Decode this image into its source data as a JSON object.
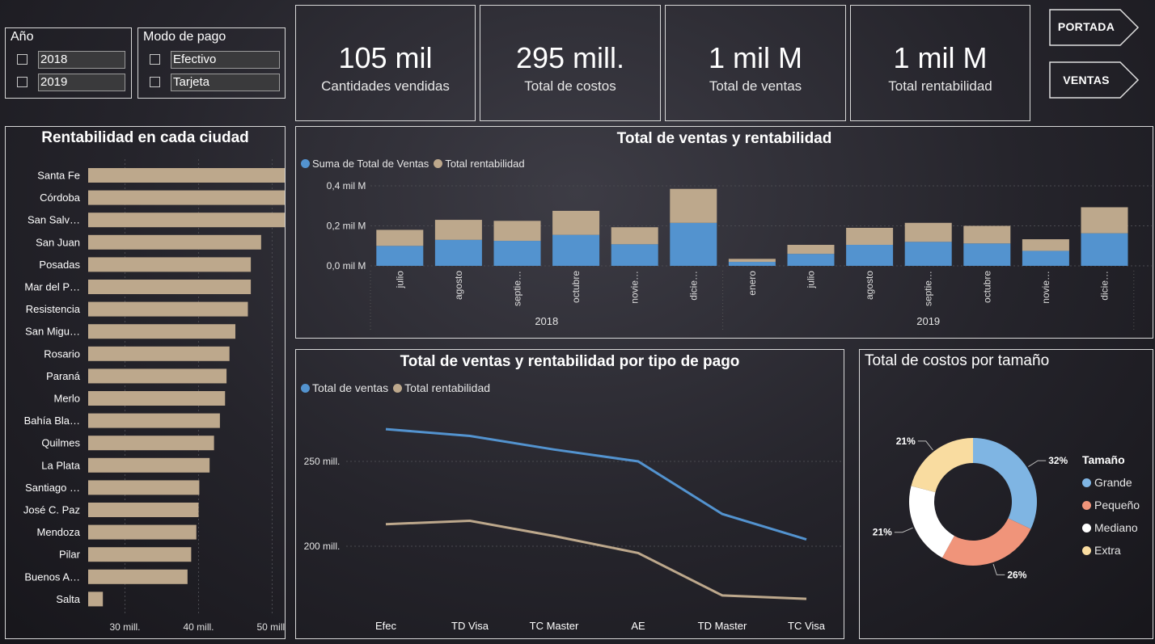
{
  "colors": {
    "blue": "#5393cf",
    "tan": "#bda88c",
    "border": "#d8d8d8",
    "grande": "#7fb5e3",
    "pequeno": "#f0947a",
    "mediano": "#ffffff",
    "extra": "#f9dca0"
  },
  "slicers": {
    "year": {
      "title": "Año",
      "options": [
        "2018",
        "2019"
      ]
    },
    "payment": {
      "title": "Modo de pago",
      "options": [
        "Efectivo",
        "Tarjeta"
      ]
    }
  },
  "kpis": [
    {
      "value": "105 mil",
      "label": "Cantidades vendidas"
    },
    {
      "value": "295 mill.",
      "label": "Total de costos"
    },
    {
      "value": "1 mil M",
      "label": "Total de ventas"
    },
    {
      "value": "1 mil M",
      "label": "Total rentabilidad"
    }
  ],
  "nav": {
    "portada": "PORTADA",
    "ventas": "VENTAS"
  },
  "charts": {
    "city": {
      "title": "Rentabilidad en cada ciudad"
    },
    "monthly": {
      "title": "Total de ventas y rentabilidad",
      "legend": [
        "Suma de Total de Ventas",
        "Total rentabilidad"
      ],
      "years": [
        "2018",
        "2019"
      ]
    },
    "payment": {
      "title": "Total de ventas y rentabilidad por tipo de pago",
      "legend": [
        "Total de ventas",
        "Total rentabilidad"
      ]
    },
    "size": {
      "title": "Total de costos por tamaño",
      "legend_title": "Tamaño",
      "legend": [
        "Grande",
        "Pequeño",
        "Mediano",
        "Extra"
      ]
    }
  },
  "chart_data": [
    {
      "type": "bar",
      "orientation": "horizontal",
      "title": "Rentabilidad en cada ciudad",
      "categories": [
        "Santa Fe",
        "Córdoba",
        "San Salv…",
        "San Juan",
        "Posadas",
        "Mar del P…",
        "Resistencia",
        "San Migu…",
        "Rosario",
        "Paraná",
        "Merlo",
        "Bahía Bla…",
        "Quilmes",
        "La Plata",
        "Santiago …",
        "José C. Paz",
        "Mendoza",
        "Pilar",
        "Buenos A…",
        "Salta"
      ],
      "values": [
        54.1,
        53.4,
        53.3,
        48.5,
        47.1,
        47.1,
        46.7,
        45.0,
        44.2,
        43.8,
        43.6,
        42.9,
        42.1,
        41.5,
        40.1,
        40.0,
        39.7,
        39.0,
        38.5,
        27.0
      ],
      "x_ticks": [
        "30 mill.",
        "40 mill.",
        "50 mill."
      ],
      "xlim_millions": [
        25,
        55
      ]
    },
    {
      "type": "bar",
      "stacked": true,
      "title": "Total de ventas y rentabilidad",
      "categories": [
        "julio",
        "agosto",
        "septie…",
        "octubre",
        "novie…",
        "dicie…",
        "enero",
        "julio",
        "agosto",
        "septie…",
        "octubre",
        "novie…",
        "dicie…"
      ],
      "year_groups": [
        {
          "label": "2018",
          "count": 6
        },
        {
          "label": "2019",
          "count": 7
        }
      ],
      "series": [
        {
          "name": "Suma de Total de Ventas",
          "values": [
            0.1,
            0.13,
            0.125,
            0.155,
            0.108,
            0.215,
            0.02,
            0.06,
            0.105,
            0.12,
            0.112,
            0.075,
            0.163
          ]
        },
        {
          "name": "Total rentabilidad",
          "values": [
            0.08,
            0.1,
            0.1,
            0.12,
            0.085,
            0.17,
            0.015,
            0.045,
            0.085,
            0.095,
            0.088,
            0.058,
            0.13
          ]
        }
      ],
      "y_ticks": [
        "0,0 mil M",
        "0,2 mil M",
        "0,4 mil M"
      ],
      "ylim_milM": [
        0,
        0.4
      ]
    },
    {
      "type": "line",
      "title": "Total de ventas y rentabilidad por tipo de pago",
      "categories": [
        "Efec",
        "TD Visa",
        "TC Master",
        "AE",
        "TD Master",
        "TC Visa"
      ],
      "series": [
        {
          "name": "Total de ventas",
          "values": [
            269,
            265,
            257,
            250,
            219,
            204
          ]
        },
        {
          "name": "Total rentabilidad",
          "values": [
            213,
            215,
            206,
            196,
            171,
            169
          ]
        }
      ],
      "y_ticks": [
        "200 mill.",
        "250 mill."
      ],
      "y_tick_values": [
        200,
        250
      ]
    },
    {
      "type": "pie",
      "donut": true,
      "title": "Total de costos por tamaño",
      "categories": [
        "Grande",
        "Pequeño",
        "Mediano",
        "Extra"
      ],
      "values": [
        32,
        26,
        21,
        21
      ],
      "labels": [
        "32%",
        "26%",
        "21%",
        "21%"
      ]
    }
  ]
}
